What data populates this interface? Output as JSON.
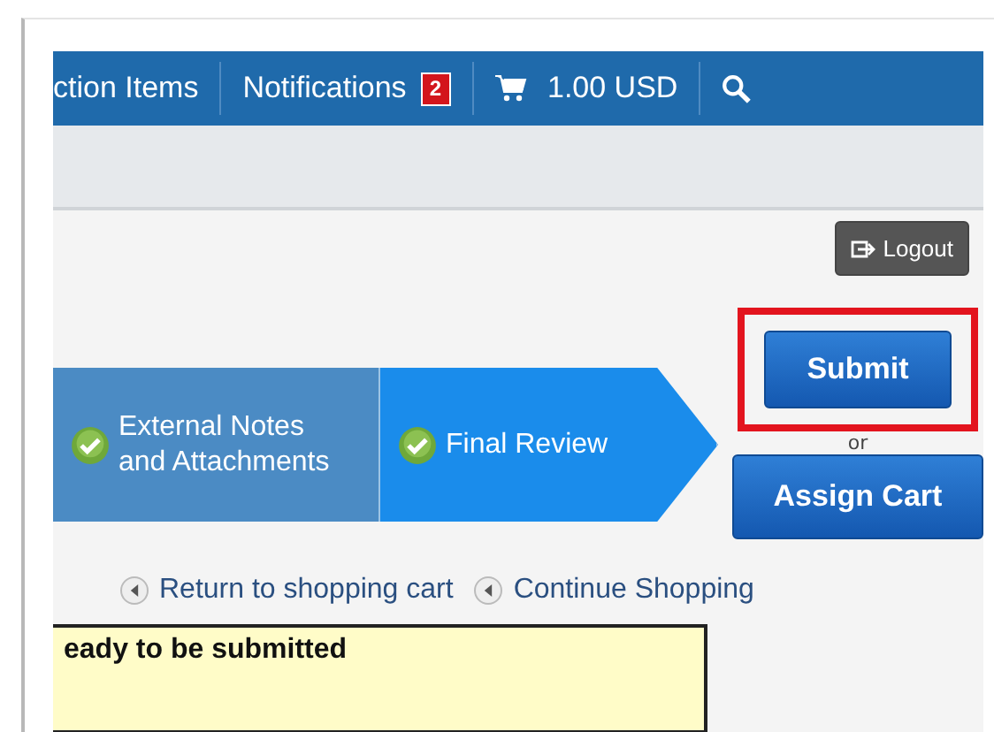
{
  "top_bar": {
    "items": [
      {
        "kind": "link",
        "label": "ction Items"
      },
      {
        "kind": "notifications",
        "label": "Notifications",
        "badge": "2"
      },
      {
        "kind": "cart",
        "label": "1.00 USD"
      },
      {
        "kind": "search"
      }
    ]
  },
  "logout_button": "Logout",
  "steps": [
    {
      "label": "External Notes and Attachments",
      "done": true,
      "selected": false
    },
    {
      "label": "Final Review",
      "done": true,
      "selected": true
    }
  ],
  "submit_button": {
    "label": "Submit",
    "highlighted": true
  },
  "or_text": "or",
  "assign_button": "Assign Cart",
  "links": [
    "Return to shopping cart",
    "Continue Shopping"
  ],
  "notice": "eady to be submitted"
}
